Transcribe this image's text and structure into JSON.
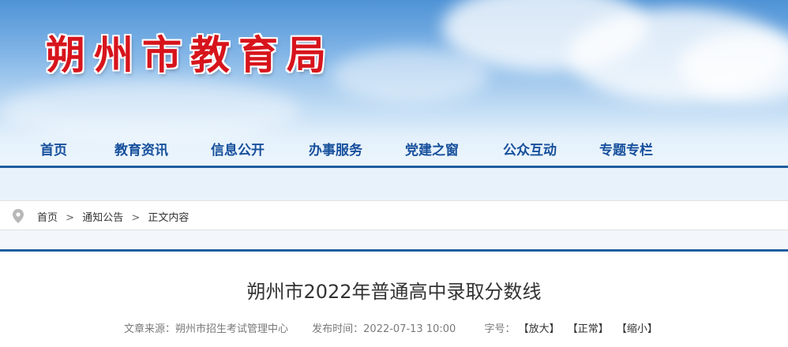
{
  "site": {
    "title": "朔州市教育局"
  },
  "nav": {
    "items": [
      "首页",
      "教育资讯",
      "信息公开",
      "办事服务",
      "党建之窗",
      "公众互动",
      "专题专栏"
    ]
  },
  "breadcrumb": {
    "items": [
      "首页",
      "通知公告",
      "正文内容"
    ],
    "separator": ">"
  },
  "article": {
    "title": "朔州市2022年普通高中录取分数线",
    "source_label": "文章来源：朔州市招生考试管理中心",
    "publish_label": "发布时间：2022-07-13 10:00",
    "font_label": "字号：",
    "font_buttons": [
      "【放大】",
      "【正常】",
      "【缩小】"
    ]
  },
  "colors": {
    "title_red": "#d7141c",
    "nav_blue": "#17509c",
    "rule_blue": "#1e5e9f",
    "band_light_blue": "#e8f2fb"
  },
  "icons": {
    "breadcrumb": "location-pin-icon"
  }
}
